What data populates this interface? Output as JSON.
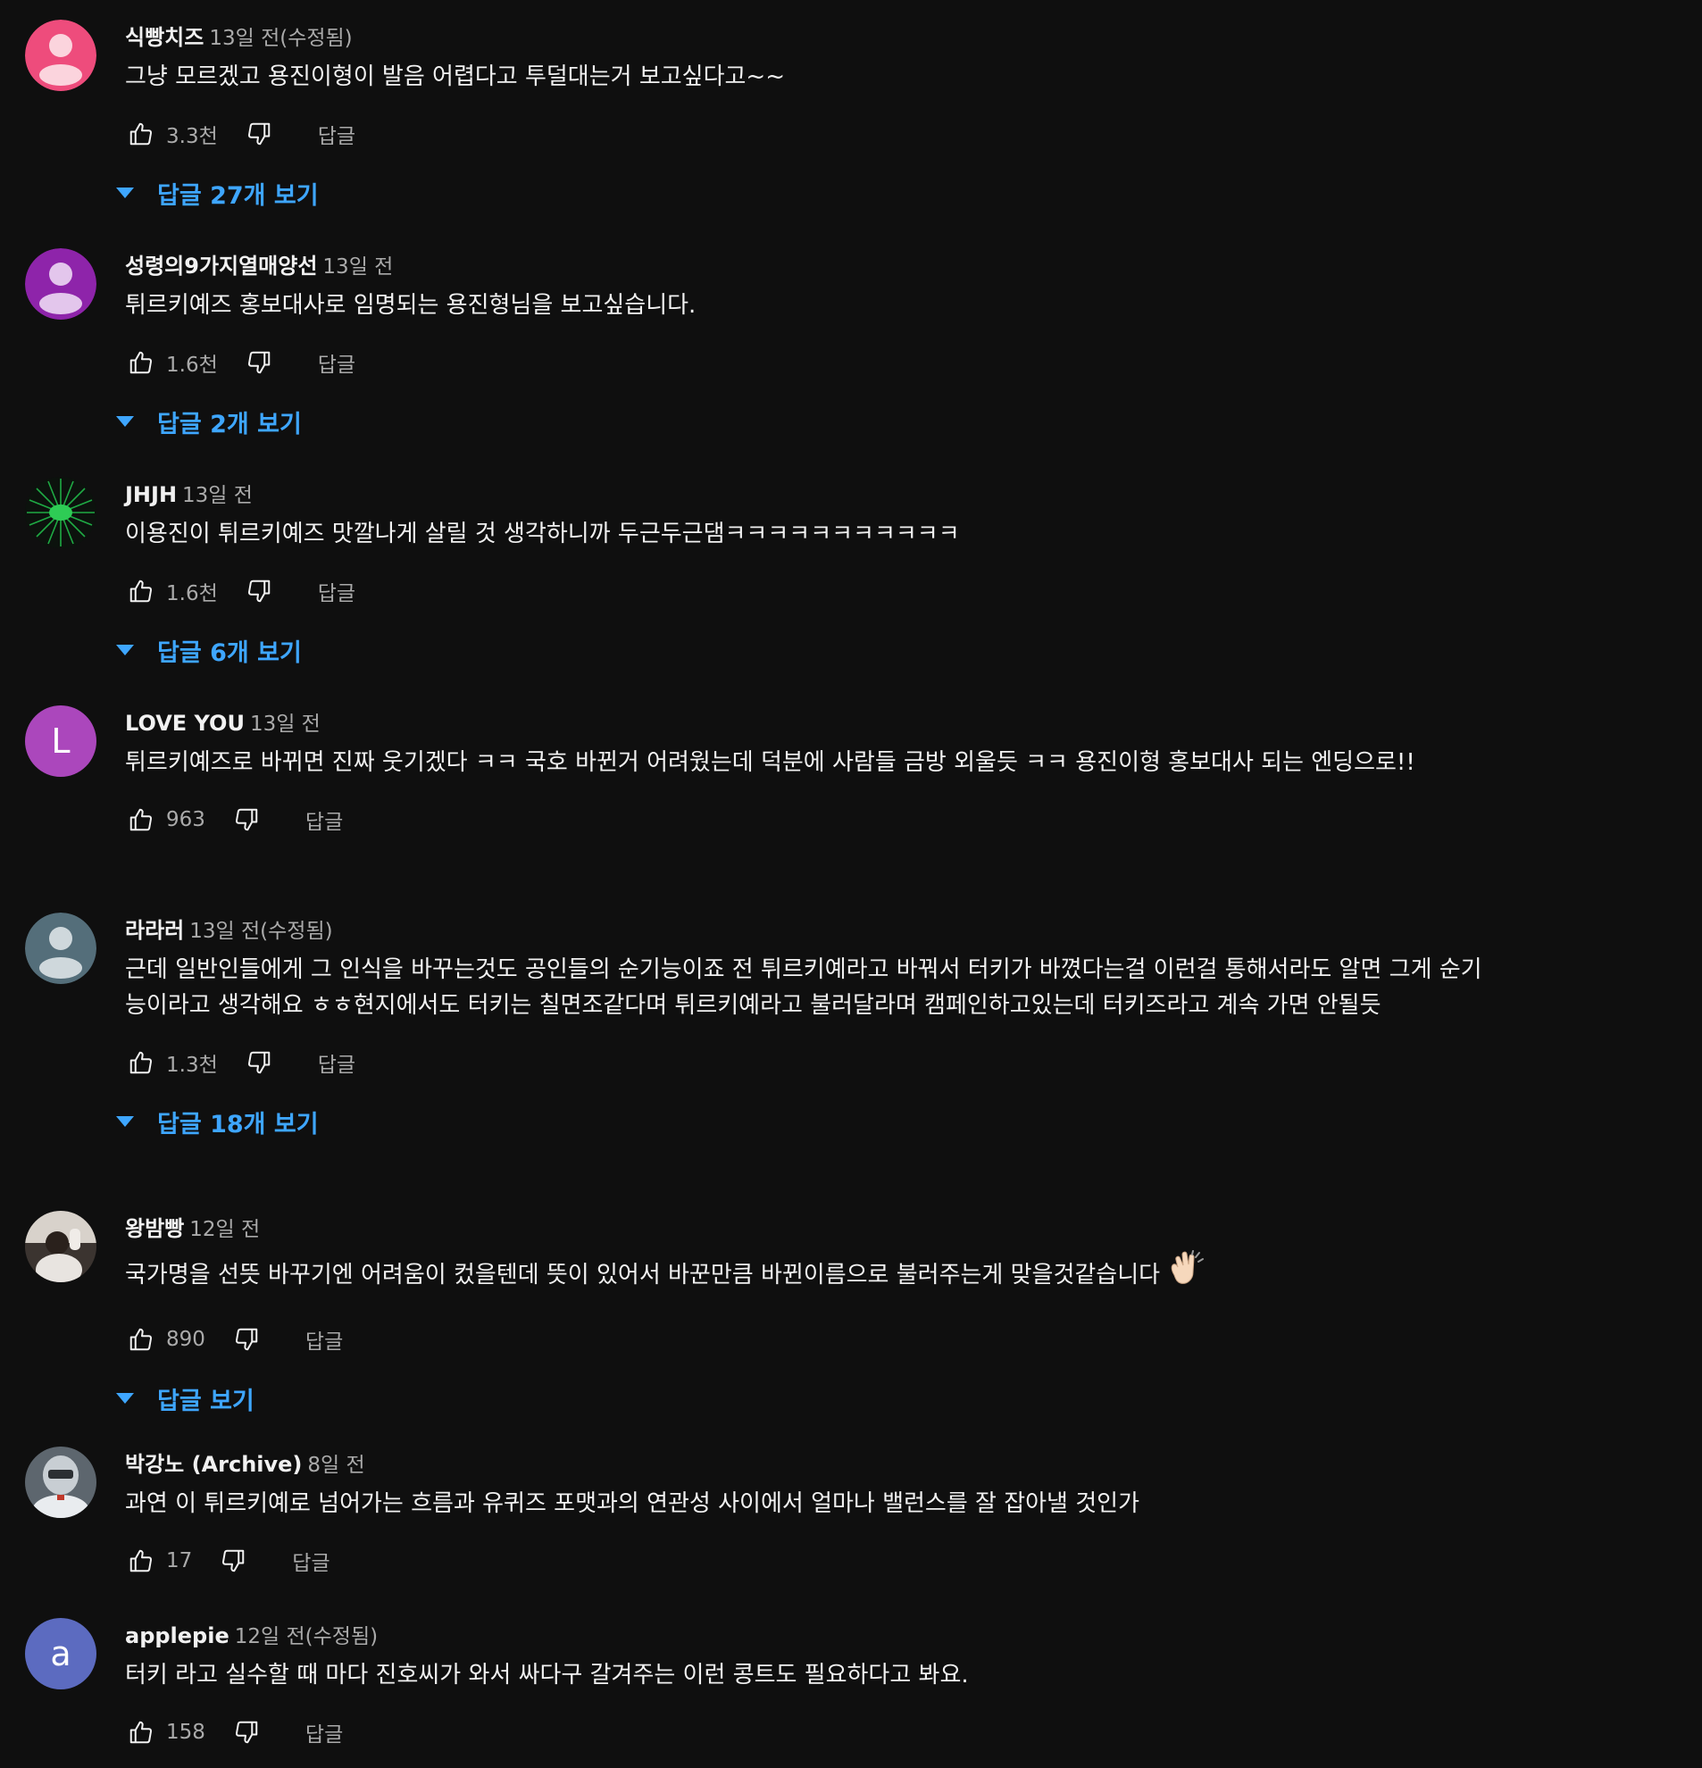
{
  "comments": [
    {
      "author": "식빵치즈",
      "time": "13일 전(수정됨)",
      "text": "그냥 모르겠고 용진이형이 발음 어렵다고 투덜대는거 보고싶다고~~",
      "likes": "3.3천",
      "reply_label": "답글",
      "view_replies": "답글 27개 보기",
      "avatar": {
        "type": "default-person-icon",
        "color": "#ee4c7c"
      }
    },
    {
      "author": "성령의9가지열매양선",
      "time": "13일 전",
      "text": "튀르키예즈 홍보대사로 임명되는 용진형님을 보고싶습니다.",
      "likes": "1.6천",
      "reply_label": "답글",
      "view_replies": "답글 2개 보기",
      "avatar": {
        "type": "default-person-icon",
        "color": "#8e24aa"
      }
    },
    {
      "author": "JHJH",
      "time": "13일 전",
      "text": "이용진이 튀르키예즈 맛깔나게 살릴 것 생각하니까 두근두근댐ㅋㅋㅋㅋㅋㅋㅋㅋㅋㅋㅋ",
      "likes": "1.6천",
      "reply_label": "답글",
      "view_replies": "답글 6개 보기",
      "avatar": {
        "type": "green-burst-image",
        "color": "#1faa44"
      }
    },
    {
      "author": "LOVE YOU",
      "time": "13일 전",
      "text": "튀르키예즈로 바뀌면 진짜 웃기겠다 ㅋㅋ 국호 바뀐거 어려웠는데 덕분에 사람들 금방 외울듯 ㅋㅋ 용진이형 홍보대사 되는 엔딩으로!!",
      "likes": "963",
      "reply_label": "답글",
      "view_replies": "",
      "avatar": {
        "type": "letter",
        "letter": "L",
        "color": "#ab47bc"
      }
    },
    {
      "author": "라라러",
      "time": "13일 전(수정됨)",
      "text": "근데 일반인들에게 그 인식을 바꾸는것도 공인들의 순기능이죠  전 튀르키예라고 바꿔서 터키가 바꼈다는걸 이런걸 통해서라도 알면 그게 순기능이라고 생각해요 ㅎㅎ현지에서도 터키는 칠면조같다며 튀르키예라고 불러달라며 캠페인하고있는데 터키즈라고 계속 가면 안될듯",
      "likes": "1.3천",
      "reply_label": "답글",
      "view_replies": "답글 18개 보기",
      "avatar": {
        "type": "default-person-icon",
        "color": "#546e7a"
      }
    },
    {
      "author": "왕밤빵",
      "time": "12일 전",
      "text": "국가명을 선뜻 바꾸기엔 어려움이 컸을텐데 뜻이 있어서 바꾼만큼 바뀐이름으로 불러주는게 맞을것같습니다",
      "emoji": "clapping-hands-icon",
      "likes": "890",
      "reply_label": "답글",
      "view_replies": "답글 보기",
      "avatar": {
        "type": "photo-person-image",
        "color": "#c9c2bb"
      }
    },
    {
      "author": "박강노 (Archive)",
      "time": "8일 전",
      "text": "과연 이 튀르키예로 넘어가는 흐름과 유퀴즈 포맷과의 연관성 사이에서 얼마나 밸런스를 잘 잡아낼 것인가",
      "likes": "17",
      "reply_label": "답글",
      "view_replies": "",
      "avatar": {
        "type": "photo-figure-image",
        "color": "#9aa4ad"
      }
    },
    {
      "author": "applepie",
      "time": "12일 전(수정됨)",
      "text": "터키 라고 실수할 때 마다 진호씨가 와서 싸다구 갈겨주는 이런 콩트도 필요하다고 봐요.",
      "likes": "158",
      "reply_label": "답글",
      "view_replies": "",
      "avatar": {
        "type": "letter",
        "letter": "a",
        "color": "#5c6bc0"
      }
    }
  ]
}
